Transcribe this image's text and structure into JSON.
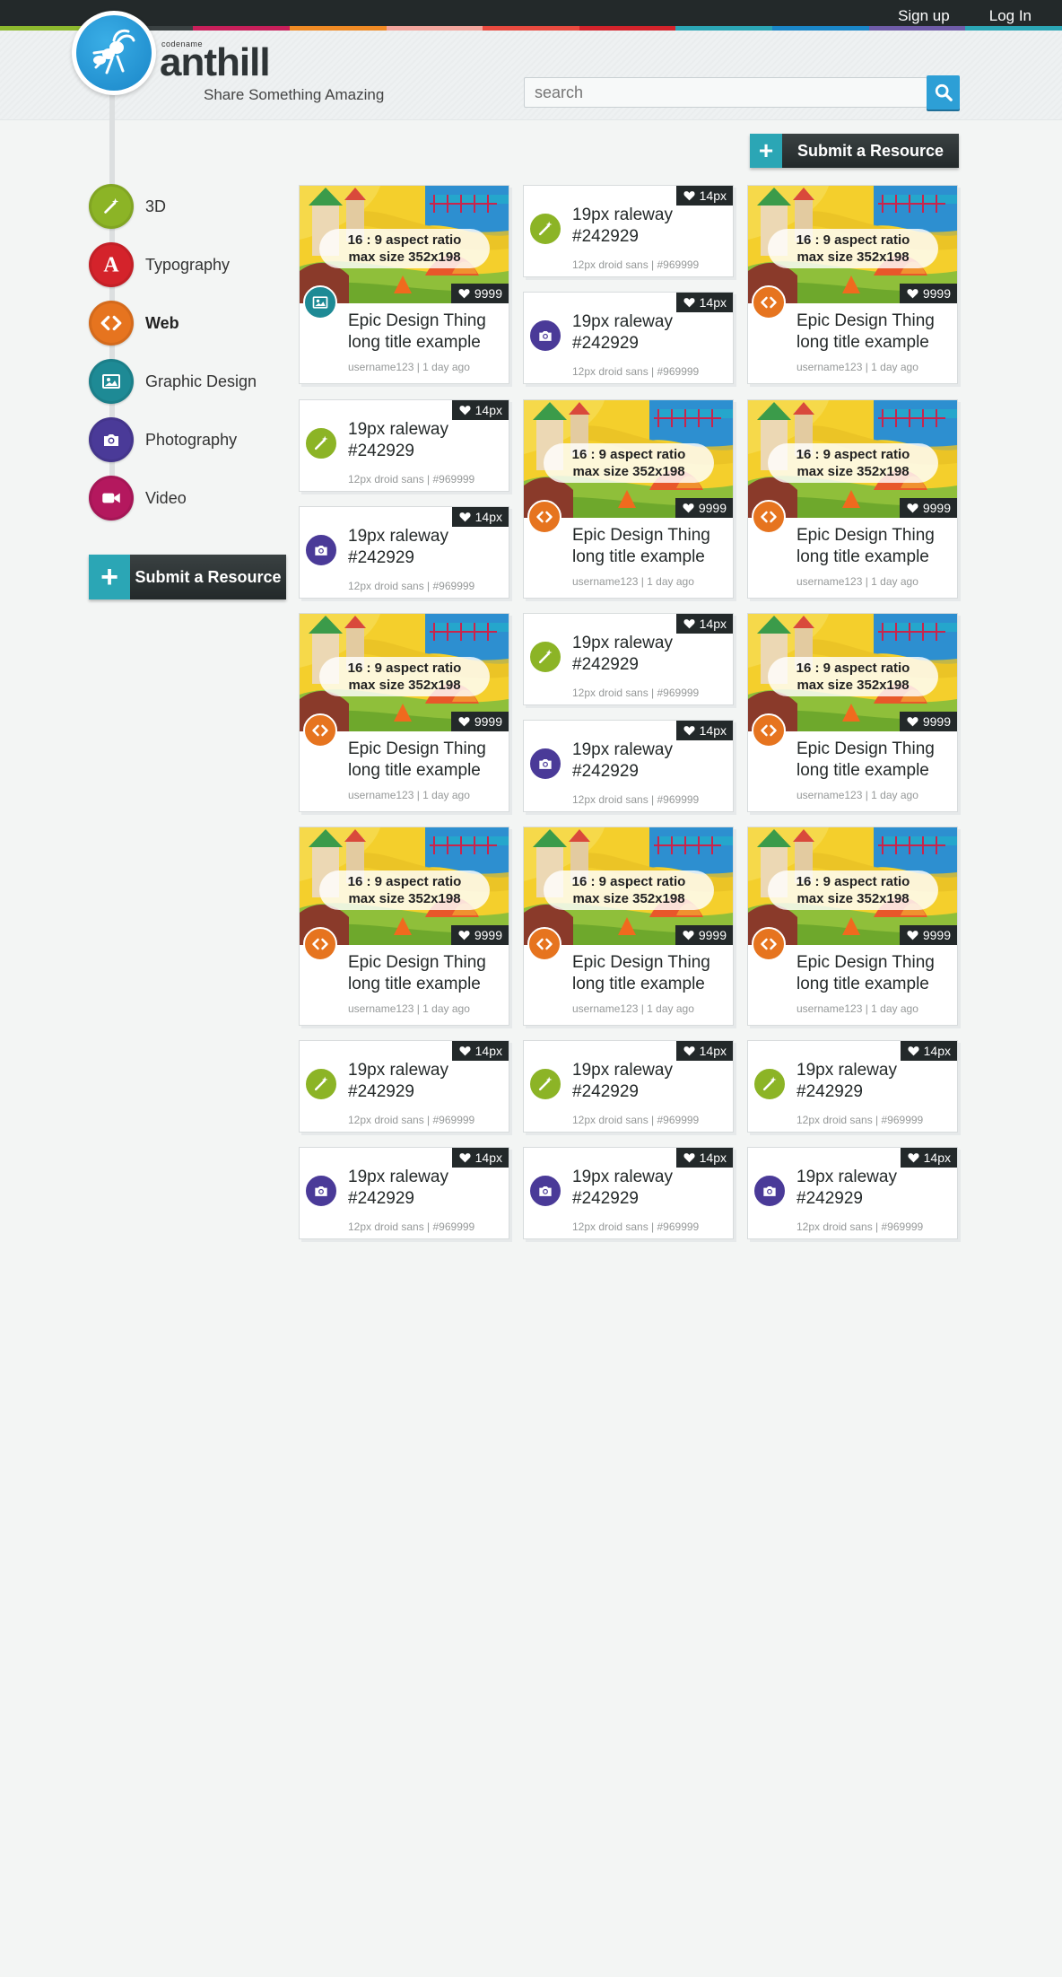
{
  "topbar": {
    "signup_label": "Sign up",
    "login_label": "Log In",
    "stripe_colors": [
      "#8db92e",
      "#3a4142",
      "#c81f5a",
      "#f08a24",
      "#f3a59c",
      "#e94a3f",
      "#d4232b",
      "#2ba6b5",
      "#1a86c8",
      "#6f5ca8",
      "#2ba6b5"
    ]
  },
  "header": {
    "logo_codename": "codename",
    "logo_name": "anthill",
    "tagline": "Share Something Amazing",
    "search_placeholder": "search"
  },
  "colors": {
    "3d": "#8cb426",
    "typography": "#d4232b",
    "web": "#e6741f",
    "graphic": "#1e8a95",
    "photo": "#4a3a98",
    "video": "#b4185e",
    "accent": "#2ba6b5",
    "search": "#2d9fd6"
  },
  "sidebar": {
    "categories": [
      {
        "label": "3D",
        "icon": "wand-icon"
      },
      {
        "label": "Typography",
        "icon": "letter-a-icon"
      },
      {
        "label": "Web",
        "icon": "code-icon"
      },
      {
        "label": "Graphic Design",
        "icon": "image-icon"
      },
      {
        "label": "Photography",
        "icon": "camera-icon"
      },
      {
        "label": "Video",
        "icon": "video-camera-icon"
      }
    ],
    "submit_label": "Submit a Resource"
  },
  "main": {
    "submit_label": "Submit a Resource",
    "placeholder_line1": "16 : 9 aspect ratio",
    "placeholder_line2": "max size 352x198",
    "cards": [
      {
        "type": "big",
        "cat": "graphic",
        "title": "Epic Design Thing long title example",
        "meta": "username123 | 1 day ago",
        "likes": "9999"
      },
      {
        "type": "small",
        "cat": "3d",
        "title": "19px raleway #242929",
        "meta": "12px droid sans | #969999",
        "likes": "14px"
      },
      {
        "type": "small",
        "cat": "photo",
        "title": "19px raleway #242929",
        "meta": "12px droid sans | #969999",
        "likes": "14px"
      },
      {
        "type": "big",
        "cat": "web",
        "title": "Epic Design Thing long title example",
        "meta": "username123 | 1 day ago",
        "likes": "9999"
      },
      {
        "type": "small",
        "cat": "3d",
        "title": "19px raleway #242929",
        "meta": "12px droid sans | #969999",
        "likes": "14px"
      },
      {
        "type": "small",
        "cat": "photo",
        "title": "19px raleway #242929",
        "meta": "12px droid sans | #969999",
        "likes": "14px"
      },
      {
        "type": "big",
        "cat": "web",
        "title": "Epic Design Thing long title example",
        "meta": "username123 | 1 day ago",
        "likes": "9999"
      },
      {
        "type": "big",
        "cat": "web",
        "title": "Epic Design Thing long title example",
        "meta": "username123 | 1 day ago",
        "likes": "9999"
      },
      {
        "type": "big",
        "cat": "web",
        "title": "Epic Design Thing long title example",
        "meta": "username123 | 1 day ago",
        "likes": "9999"
      },
      {
        "type": "small",
        "cat": "3d",
        "title": "19px raleway #242929",
        "meta": "12px droid sans | #969999",
        "likes": "14px"
      },
      {
        "type": "small",
        "cat": "photo",
        "title": "19px raleway #242929",
        "meta": "12px droid sans | #969999",
        "likes": "14px"
      },
      {
        "type": "big",
        "cat": "web",
        "title": "Epic Design Thing long title example",
        "meta": "username123 | 1 day ago",
        "likes": "9999"
      },
      {
        "type": "big",
        "cat": "web",
        "title": "Epic Design Thing long title example",
        "meta": "username123 | 1 day ago",
        "likes": "9999"
      },
      {
        "type": "big",
        "cat": "web",
        "title": "Epic Design Thing long title example",
        "meta": "username123 | 1 day ago",
        "likes": "9999"
      },
      {
        "type": "big",
        "cat": "web",
        "title": "Epic Design Thing long title example",
        "meta": "username123 | 1 day ago",
        "likes": "9999"
      },
      {
        "type": "small",
        "cat": "3d",
        "title": "19px raleway #242929",
        "meta": "12px droid sans | #969999",
        "likes": "14px"
      },
      {
        "type": "small",
        "cat": "3d",
        "title": "19px raleway #242929",
        "meta": "12px droid sans | #969999",
        "likes": "14px"
      },
      {
        "type": "small",
        "cat": "3d",
        "title": "19px raleway #242929",
        "meta": "12px droid sans | #969999",
        "likes": "14px"
      },
      {
        "type": "small",
        "cat": "photo",
        "title": "19px raleway #242929",
        "meta": "12px droid sans | #969999",
        "likes": "14px"
      },
      {
        "type": "small",
        "cat": "photo",
        "title": "19px raleway #242929",
        "meta": "12px droid sans | #969999",
        "likes": "14px"
      },
      {
        "type": "small",
        "cat": "photo",
        "title": "19px raleway #242929",
        "meta": "12px droid sans | #969999",
        "likes": "14px"
      }
    ]
  }
}
